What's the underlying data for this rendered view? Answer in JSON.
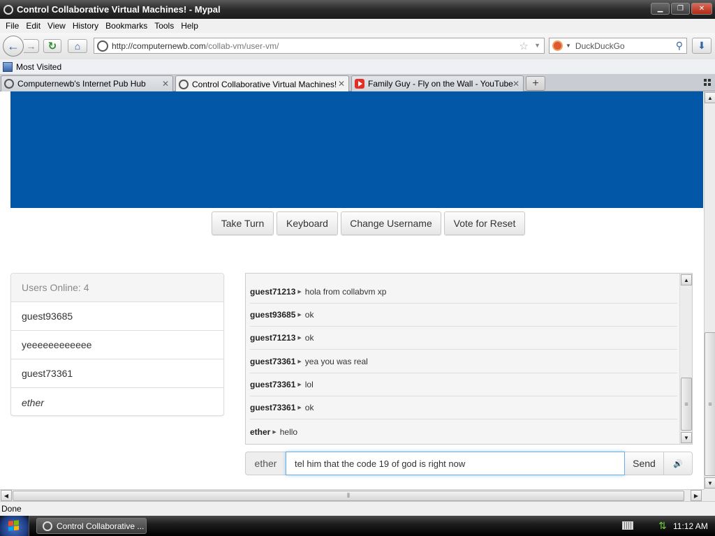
{
  "window": {
    "title": "Control Collaborative Virtual Machines! - Mypal",
    "minimize": "▁",
    "maximize": "❐",
    "close": "✕"
  },
  "menu": [
    "File",
    "Edit",
    "View",
    "History",
    "Bookmarks",
    "Tools",
    "Help"
  ],
  "nav": {
    "url_prefix": "http://computernewb.com",
    "url_path": "/collab-vm/user-vm/",
    "search_placeholder": "DuckDuckGo"
  },
  "bookmarks": {
    "most_visited": "Most Visited"
  },
  "tabs": [
    {
      "label": "Computernewb's Internet Pub Hub",
      "active": false
    },
    {
      "label": "Control Collaborative Virtual Machines!",
      "active": true
    },
    {
      "label": "Family Guy - Fly on the Wall - YouTube",
      "active": false
    }
  ],
  "vm_controls": {
    "take_turn": "Take Turn",
    "keyboard": "Keyboard",
    "change_username": "Change Username",
    "vote_reset": "Vote for Reset"
  },
  "users": {
    "header": "Users Online: 4",
    "list": [
      {
        "name": "guest93685",
        "italic": false
      },
      {
        "name": "yeeeeeeeeeeee",
        "italic": false
      },
      {
        "name": "guest73361",
        "italic": false
      },
      {
        "name": "ether",
        "italic": true
      }
    ]
  },
  "chat": {
    "messages": [
      {
        "user": "guest71213",
        "text": "hola from collabvm xp"
      },
      {
        "user": "guest93685",
        "text": "ok"
      },
      {
        "user": "guest71213",
        "text": "ok"
      },
      {
        "user": "guest73361",
        "text": "yea you was real"
      },
      {
        "user": "guest73361",
        "text": "lol"
      },
      {
        "user": "guest73361",
        "text": "ok"
      },
      {
        "user": "ether",
        "text": "hello"
      }
    ],
    "username": "ether",
    "input_value": "tel him that the code 19 of god is right now",
    "send_label": "Send"
  },
  "status": {
    "text": "Done"
  },
  "taskbar": {
    "task_label": "Control Collaborative ...",
    "clock": "11:12 AM"
  },
  "colors": {
    "vm_screen": "#0257a6",
    "focus_ring": "#66afe9"
  }
}
